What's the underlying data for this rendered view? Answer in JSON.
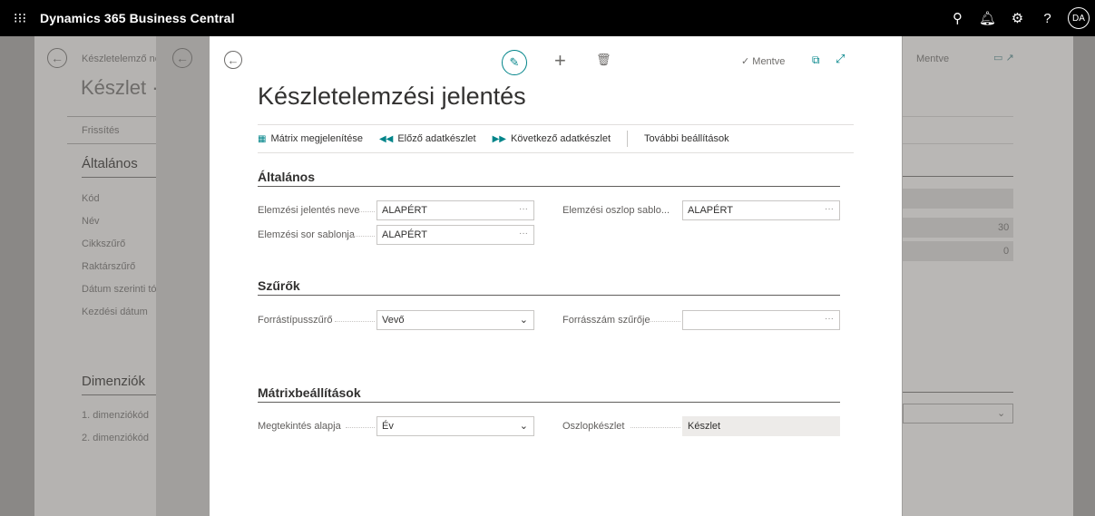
{
  "app": {
    "title": "Dynamics 365 Business Central",
    "avatar": "DA"
  },
  "icons": {
    "waffle": "waffle-icon",
    "search": "search-icon",
    "bell": "bell-icon",
    "settings": "gear-icon",
    "help": "question-icon"
  },
  "background": {
    "breadcrumb": "Készletelemző ne",
    "page_title": "Készlet ·",
    "refresh": "Frissítés",
    "general": "Általános",
    "fields": [
      "Kód",
      "Név",
      "Cikkszűrő",
      "Raktárszűrő",
      "Dátum szerinti tó",
      "Kezdési dátum"
    ],
    "dimensions": "Dimenziók",
    "dim_fields": [
      "1. dimenziókód",
      "2. dimenziókód"
    ],
    "right_saved": "Mentve",
    "right_values": [
      "30",
      "0"
    ]
  },
  "dialog": {
    "saved": "Mentve",
    "title": "Készletelemzési jelentés",
    "actions": {
      "show_matrix": "Mátrix megjelenítése",
      "prev_set": "Előző adatkészlet",
      "next_set": "Következő adatkészlet",
      "more_options": "További beállítások"
    },
    "general": {
      "title": "Általános",
      "analysis_name_label": "Elemzési jelentés neve",
      "analysis_name_value": "ALAPÉRT",
      "line_template_label": "Elemzési sor sablonja",
      "line_template_value": "ALAPÉRT",
      "column_template_label": "Elemzési oszlop sablo...",
      "column_template_value": "ALAPÉRT"
    },
    "filters": {
      "title": "Szűrők",
      "source_type_label": "Forrástípusszűrő",
      "source_type_value": "Vevő",
      "source_no_label": "Forrásszám szűrője",
      "source_no_value": ""
    },
    "matrix": {
      "title": "Mátrixbeállítások",
      "view_by_label": "Megtekintés alapja",
      "view_by_value": "Év",
      "column_set_label": "Oszlopkészlet",
      "column_set_value": "Készlet"
    }
  }
}
